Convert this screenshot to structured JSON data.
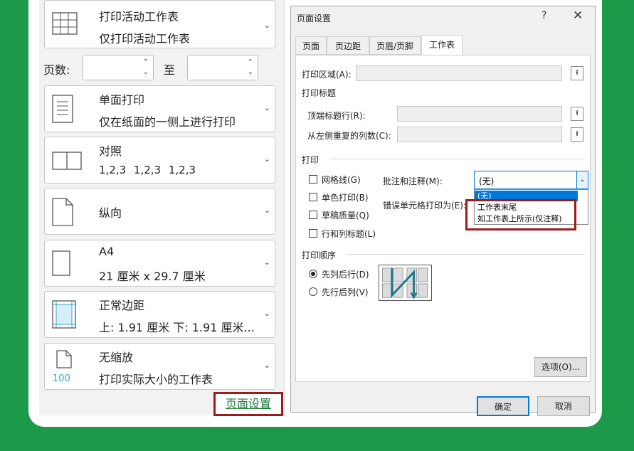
{
  "print_panel": {
    "options": [
      {
        "title": "打印活动工作表",
        "subtitle": "仅打印活动工作表",
        "icon": "grid-sheet-icon"
      },
      {
        "title": "单面打印",
        "subtitle": "仅在纸面的一侧上进行打印",
        "icon": "single-side-icon"
      },
      {
        "title": "对照",
        "subtitle": "1,2,3    1,2,3    1,2,3",
        "icon": "collate-icon"
      },
      {
        "title": "纵向",
        "subtitle": "",
        "icon": "portrait-icon"
      },
      {
        "title": "A4",
        "subtitle": "21 厘米 x 29.7 厘米",
        "icon": "paper-size-icon"
      },
      {
        "title": "正常边距",
        "subtitle": "上: 1.91 厘米 下: 1.91 厘米...",
        "icon": "margins-icon"
      },
      {
        "title": "无缩放",
        "subtitle": "打印实际大小的工作表",
        "icon": "scaling-icon",
        "icon_text": "100"
      }
    ],
    "pages_label": "页数:",
    "to_label": "至",
    "page_setup_link": "页面设置"
  },
  "dialog": {
    "title": "页面设置",
    "help": "?",
    "close": "✕",
    "tabs": [
      "页面",
      "页边距",
      "页眉/页脚",
      "工作表"
    ],
    "active_tab": "工作表",
    "print_area_label": "打印区域(A):",
    "print_titles_section": "打印标题",
    "rows_to_repeat_label": "顶端标题行(R):",
    "cols_to_repeat_label": "从左侧重复的列数(C):",
    "print_section": "打印",
    "checkboxes": [
      "网格线(G)",
      "单色打印(B)",
      "草稿质量(Q)",
      "行和列标题(L)"
    ],
    "comments_label": "批注和注释(M):",
    "comments_value": "(无)",
    "errors_label": "错误单元格打印为(E):",
    "dropdown_options": [
      "(无)",
      "工作表末尾",
      "如工作表上所示(仅注释)"
    ],
    "page_order_section": "打印顺序",
    "order_options": [
      "先列后行(D)",
      "先行后列(V)"
    ],
    "order_selected": "先列后行(D)",
    "options_button": "选项(O)...",
    "ok_button": "确定",
    "cancel_button": "取消"
  },
  "colors": {
    "background": "#1c9a4a",
    "highlight": "#9b1c1c",
    "link": "#1b7a3a",
    "accent": "#0078d7"
  }
}
